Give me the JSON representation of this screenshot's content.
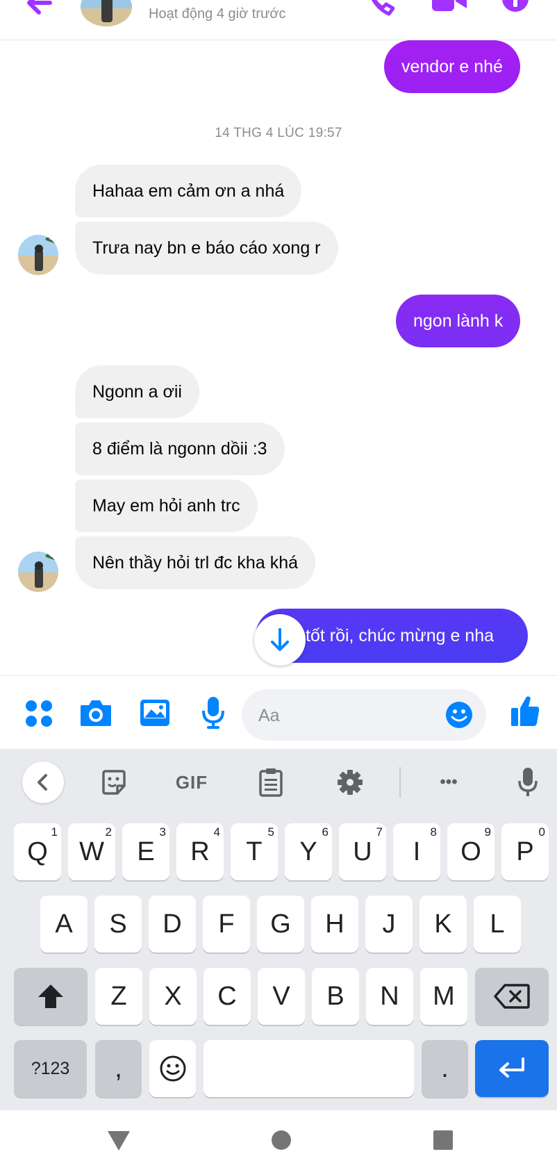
{
  "header": {
    "status": "Hoạt động 4 giờ trước"
  },
  "colors": {
    "accent_purple": "#a033ff",
    "accent_blue": "#0084ff",
    "bubble_gradient_top": "#a020f0",
    "bubble_gradient_bottom": "#4a3cf4",
    "incoming_bubble": "#f0f0f0",
    "enter_key": "#1a73e8"
  },
  "messages": [
    {
      "direction": "out",
      "text": "vendor e nhé"
    },
    {
      "direction": "timestamp",
      "text": "14 THG 4 LÚC 19:57"
    },
    {
      "direction": "in",
      "text": "Hahaa em cảm ơn a nhá"
    },
    {
      "direction": "in",
      "text": "Trưa nay bn e báo cáo xong r"
    },
    {
      "direction": "out",
      "text": "ngon lành k"
    },
    {
      "direction": "in",
      "text": "Ngonn a ơii"
    },
    {
      "direction": "in",
      "text": "8 điểm là ngonn dồii :3"
    },
    {
      "direction": "in",
      "text": "May em hỏi anh trc"
    },
    {
      "direction": "in",
      "text": "Nên thầy hỏi trl đc kha khá"
    },
    {
      "direction": "out",
      "text": "tốt rồi, chúc mừng e nha"
    }
  ],
  "composer": {
    "placeholder": "Aa",
    "icons": [
      "menu-icon",
      "camera-icon",
      "gallery-icon",
      "microphone-icon",
      "emoji-icon",
      "thumbs-up-icon"
    ]
  },
  "keyboard": {
    "toolbar": {
      "gif_label": "GIF",
      "more_label": "•••",
      "icons": [
        "back-chevron-icon",
        "sticker-icon",
        "clipboard-icon",
        "settings-icon",
        "voice-input-icon"
      ]
    },
    "row1": [
      {
        "label": "Q",
        "num": "1"
      },
      {
        "label": "W",
        "num": "2"
      },
      {
        "label": "E",
        "num": "3"
      },
      {
        "label": "R",
        "num": "4"
      },
      {
        "label": "T",
        "num": "5"
      },
      {
        "label": "Y",
        "num": "6"
      },
      {
        "label": "U",
        "num": "7"
      },
      {
        "label": "I",
        "num": "8"
      },
      {
        "label": "O",
        "num": "9"
      },
      {
        "label": "P",
        "num": "0"
      }
    ],
    "row2": [
      "A",
      "S",
      "D",
      "F",
      "G",
      "H",
      "J",
      "K",
      "L"
    ],
    "row3": [
      "Z",
      "X",
      "C",
      "V",
      "B",
      "N",
      "M"
    ],
    "symbols_label": "?123",
    "comma_label": ",",
    "period_label": ".",
    "icons": [
      "shift-icon",
      "backspace-icon",
      "emoji-key-icon",
      "enter-icon"
    ]
  },
  "navbar": {
    "icons": [
      "nav-back-icon",
      "nav-home-icon",
      "nav-recents-icon"
    ]
  }
}
